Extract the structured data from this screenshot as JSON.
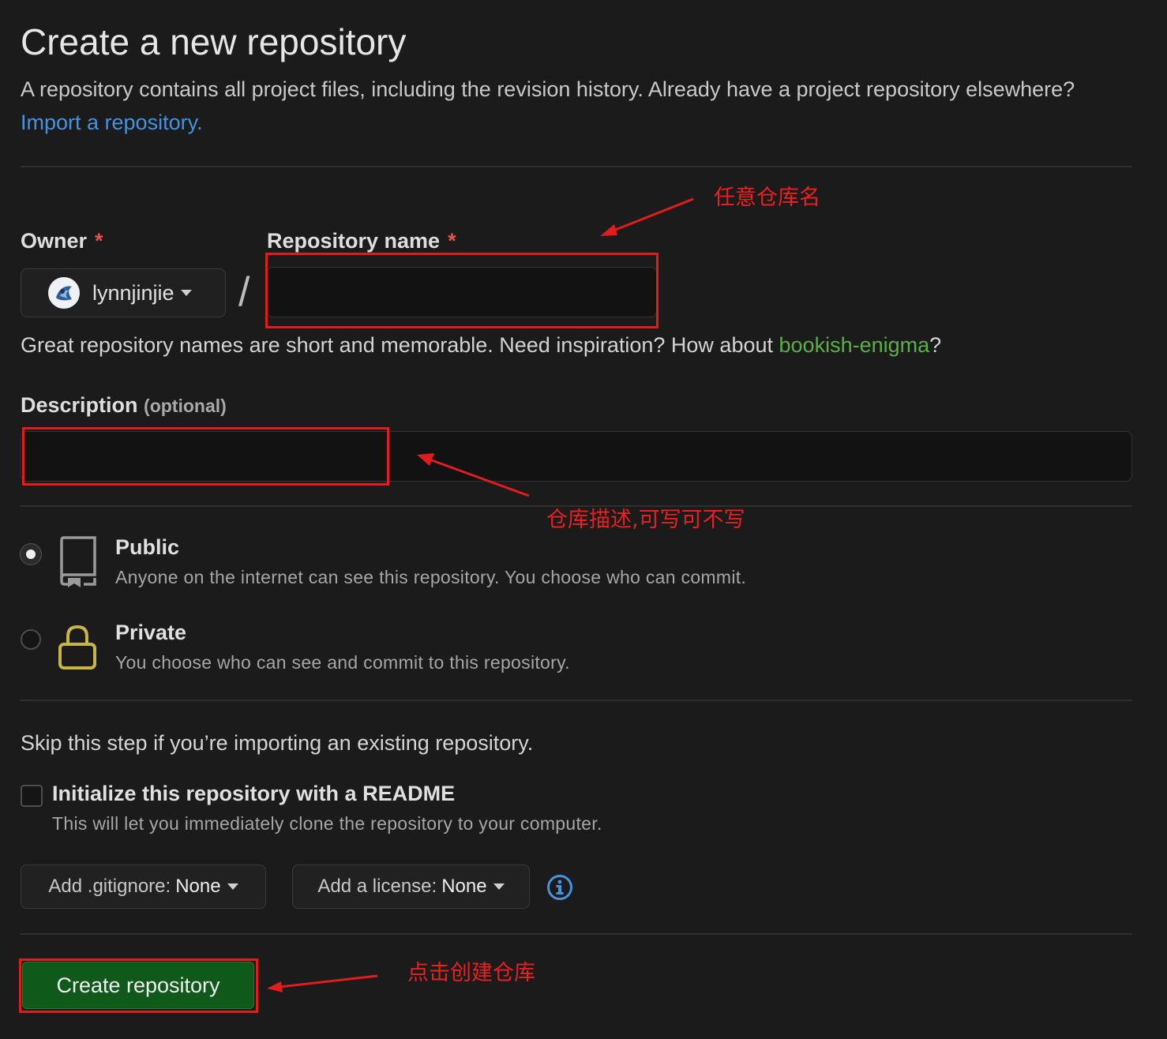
{
  "page": {
    "title": "Create a new repository",
    "intro_text": "A repository contains all project files, including the revision history. Already have a project repository elsewhere?",
    "import_link": "Import a repository."
  },
  "owner": {
    "label": "Owner",
    "required_mark": "*",
    "value": "lynnjinjie"
  },
  "separator": "/",
  "repo_name": {
    "label": "Repository name",
    "required_mark": "*",
    "value": ""
  },
  "name_hint": {
    "text": "Great repository names are short and memorable. Need inspiration? How about",
    "suggestion": "bookish-enigma",
    "suffix": "?"
  },
  "description": {
    "label": "Description",
    "optional": "(optional)",
    "value": ""
  },
  "visibility": {
    "public": {
      "title": "Public",
      "desc": "Anyone on the internet can see this repository. You choose who can commit.",
      "selected": true
    },
    "private": {
      "title": "Private",
      "desc": "You choose who can see and commit to this repository.",
      "selected": false
    }
  },
  "init": {
    "skip_text": "Skip this step if you’re importing an existing repository.",
    "readme_title": "Initialize this repository with a README",
    "readme_desc": "This will let you immediately clone the repository to your computer.",
    "readme_checked": false
  },
  "gitignore": {
    "label": "Add .gitignore:",
    "value": "None"
  },
  "license": {
    "label": "Add a license:",
    "value": "None"
  },
  "create_button": "Create repository",
  "annotations": {
    "repo_name": "任意仓库名",
    "description": "仓库描述,可写可不写",
    "create": "点击创建仓库"
  },
  "colors": {
    "background": "#1b1b1b",
    "link_blue": "#4493e2",
    "link_green": "#5bb045",
    "annotation_red": "#e21c1c",
    "create_green": "#0f5a1a",
    "lock_yellow": "#c9b447"
  },
  "icons": [
    "caret-down-icon",
    "repo-book-icon",
    "lock-icon",
    "info-icon",
    "avatar"
  ]
}
